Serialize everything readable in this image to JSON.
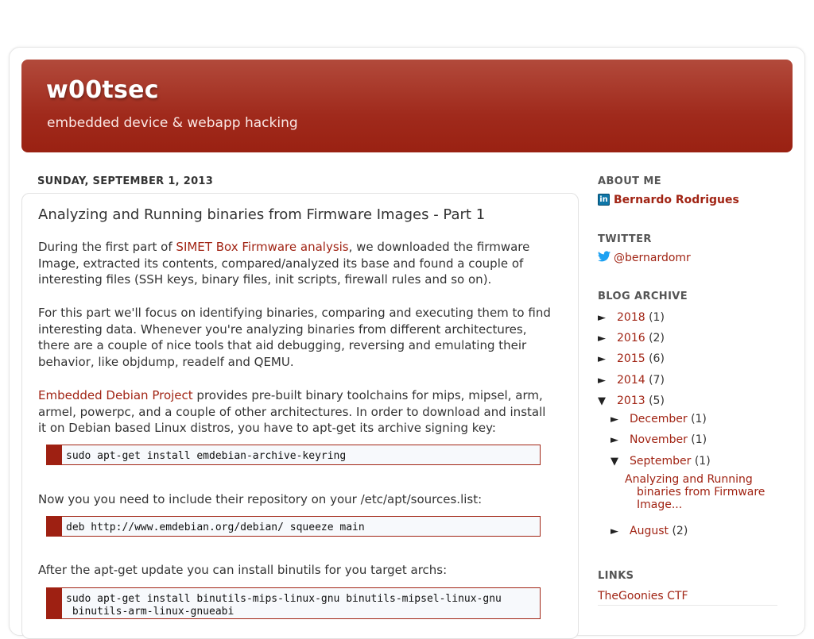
{
  "blog": {
    "title": "w00tsec",
    "description": "embedded device & webapp hacking"
  },
  "post": {
    "date": "SUNDAY, SEPTEMBER 1, 2013",
    "title": "Analyzing and Running binaries from Firmware Images - Part 1",
    "p1_pre": "During the first part of ",
    "p1_link": "SIMET Box Firmware analysis",
    "p1_post": ", we downloaded the firmware Image, extracted its contents, compared/analyzed its base and found a couple of interesting files (SSH keys, binary files, init scripts, firewall rules and so on).",
    "p2": "For this part we'll focus on identifying binaries, comparing and executing them to find interesting data. Whenever you're analyzing binaries from different architectures, there are a couple of nice tools that aid debugging, reversing and emulating their behavior, like objdump, readelf and QEMU.",
    "p3_link": "Embedded Debian Project",
    "p3_post": "  provides pre-built binary toolchains for mips, mipsel, arm, armel, powerpc, and a couple of other architectures. In order to download and install it on Debian based Linux distros, you have to apt-get its archive signing key:",
    "code1": "sudo apt-get install emdebian-archive-keyring",
    "p4": "Now you you need to include their repository on your /etc/apt/sources.list:",
    "code2": "deb http://www.emdebian.org/debian/ squeeze main",
    "p5": "After the apt-get update you can install binutils for you target archs:",
    "code3_line1": "sudo apt-get install binutils-mips-linux-gnu binutils-mipsel-linux-gnu",
    "code3_line2": " binutils-arm-linux-gnueabi"
  },
  "sidebar": {
    "about_heading": "ABOUT ME",
    "author": "Bernardo Rodrigues",
    "twitter_heading": "TWITTER",
    "twitter_handle": "@bernardomr",
    "archive_heading": "BLOG ARCHIVE",
    "archive": [
      {
        "arrow": "►",
        "label": "2018",
        "count": "(1)"
      },
      {
        "arrow": "►",
        "label": "2016",
        "count": "(2)"
      },
      {
        "arrow": "►",
        "label": "2015",
        "count": "(6)"
      },
      {
        "arrow": "►",
        "label": "2014",
        "count": "(7)"
      },
      {
        "arrow": "▼",
        "label": "2013",
        "count": "(5)"
      }
    ],
    "months": [
      {
        "arrow": "►",
        "label": "December",
        "count": "(1)"
      },
      {
        "arrow": "►",
        "label": "November",
        "count": "(1)"
      },
      {
        "arrow": "▼",
        "label": "September",
        "count": "(1)"
      },
      {
        "arrow": "►",
        "label": "August",
        "count": "(2)"
      }
    ],
    "post_link_line1": "Analyzing and Running",
    "post_link_line2": "binaries from Firmware",
    "post_link_line3": "Image...",
    "links_heading": "LINKS",
    "links": [
      "TheGoonies CTF"
    ]
  },
  "colors": {
    "accent": "#a12414",
    "header_top": "#b24a3b",
    "header_bottom": "#9a2112"
  }
}
